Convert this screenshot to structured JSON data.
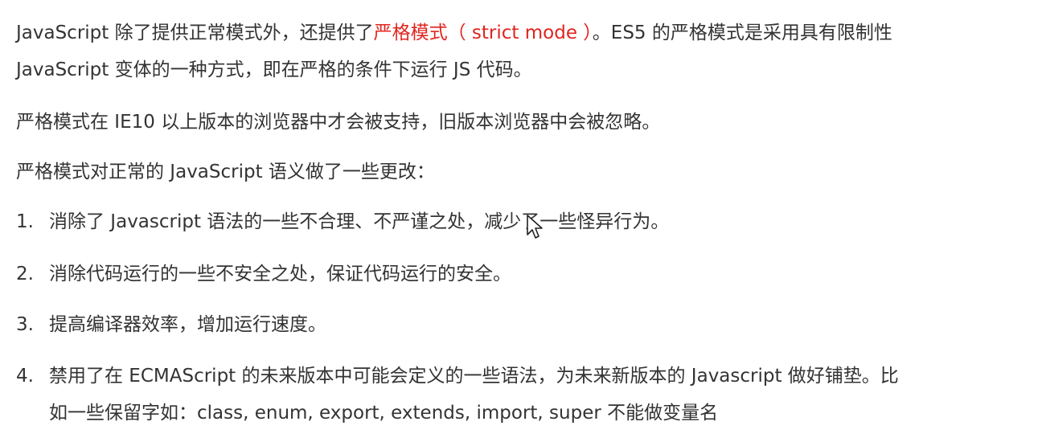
{
  "doc": {
    "intro": {
      "line1_prefix": "JavaScript 除了提供正常模式外，还提供了",
      "line1_highlight": "严格模式（ strict mode ）",
      "line1_suffix": "。ES5 的严格模式是采用具有限制性",
      "line2": "JavaScript 变体的一种方式，即在严格的条件下运行 JS 代码。"
    },
    "support": "严格模式在 IE10 以上版本的浏览器中才会被支持，旧版本浏览器中会被忽略。",
    "changes_intro": "严格模式对正常的 JavaScript 语义做了一些更改：",
    "list": [
      {
        "num": "1.",
        "text": "消除了 Javascript 语法的一些不合理、不严谨之处，减少了一些怪异行为。"
      },
      {
        "num": "2.",
        "text": "消除代码运行的一些不安全之处，保证代码运行的安全。"
      },
      {
        "num": "3.",
        "text": "提高编译器效率，增加运行速度。"
      },
      {
        "num": "4.",
        "text_line1": "禁用了在 ECMAScript 的未来版本中可能会定义的一些语法，为未来新版本的 Javascript 做好铺垫。比",
        "text_line2": "如一些保留字如：class, enum, export, extends, import, super 不能做变量名"
      }
    ]
  },
  "colors": {
    "text": "#333333",
    "highlight": "#e0251f",
    "background": "#ffffff"
  },
  "icons": {
    "cursor": "mouse-pointer-icon"
  }
}
